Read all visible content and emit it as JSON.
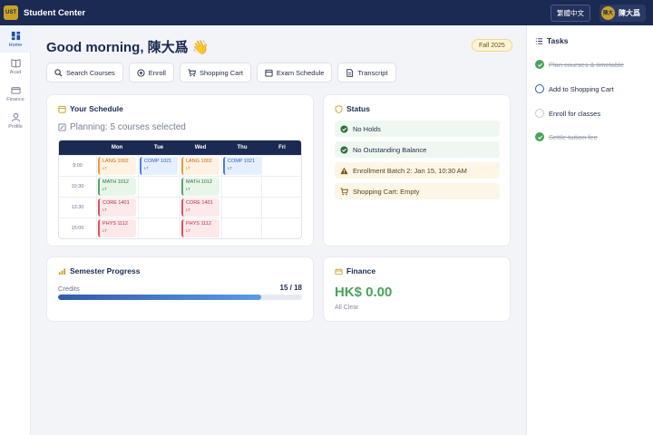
{
  "app": {
    "logo": "UST",
    "title": "Student Center"
  },
  "topbar": {
    "lang_button": "繁體中文",
    "avatar_initials": "陳大",
    "user_name": "陳大爲"
  },
  "nav": [
    {
      "label": "Home",
      "icon": "dashboard-icon",
      "active": true
    },
    {
      "label": "Acad",
      "icon": "book-icon",
      "active": false
    },
    {
      "label": "Finance",
      "icon": "wallet-icon",
      "active": false
    },
    {
      "label": "Profile",
      "icon": "person-icon",
      "active": false
    }
  ],
  "main": {
    "greeting": "Good morning, 陳大爲 👋",
    "term_badge": "Fall 2025",
    "actions": [
      {
        "label": "Search Courses",
        "icon": "search-icon"
      },
      {
        "label": "Enroll",
        "icon": "plus-circle-icon"
      },
      {
        "label": "Shopping Cart",
        "icon": "cart-icon"
      },
      {
        "label": "Exam Schedule",
        "icon": "calendar-icon"
      },
      {
        "label": "Transcript",
        "icon": "document-icon"
      }
    ]
  },
  "schedule": {
    "title": "Your Schedule",
    "planning_text": "Planning: 5 courses selected",
    "days": [
      "Mon",
      "Tue",
      "Wed",
      "Thu",
      "Fri"
    ],
    "times": [
      "9:00",
      "10:30",
      "13:30",
      "15:00"
    ],
    "blocks": [
      {
        "code": "LANG 1002",
        "type": "LT",
        "day": 0,
        "slot": 0,
        "kind": "lang"
      },
      {
        "code": "COMP 1021",
        "type": "LT",
        "day": 1,
        "slot": 0,
        "kind": "comp"
      },
      {
        "code": "LANG 1002",
        "type": "LT",
        "day": 2,
        "slot": 0,
        "kind": "lang"
      },
      {
        "code": "COMP 1021",
        "type": "LT",
        "day": 3,
        "slot": 0,
        "kind": "comp"
      },
      {
        "code": "MATH 1012",
        "type": "LT",
        "day": 0,
        "slot": 1,
        "kind": "math"
      },
      {
        "code": "MATH 1012",
        "type": "LT",
        "day": 2,
        "slot": 1,
        "kind": "math"
      },
      {
        "code": "CORE 1401",
        "type": "LT",
        "day": 0,
        "slot": 2,
        "kind": "core"
      },
      {
        "code": "CORE 1401",
        "type": "LT",
        "day": 2,
        "slot": 2,
        "kind": "core"
      },
      {
        "code": "PHYS 1112",
        "type": "LT",
        "day": 0,
        "slot": 3,
        "kind": "phys"
      },
      {
        "code": "PHYS 1112",
        "type": "LT",
        "day": 2,
        "slot": 3,
        "kind": "phys"
      }
    ]
  },
  "status": {
    "title": "Status",
    "items": [
      {
        "text": "No Holds",
        "level": "ok"
      },
      {
        "text": "No Outstanding Balance",
        "level": "ok"
      },
      {
        "text": "Enrollment Batch 2: Jan 15, 10:30 AM",
        "level": "warn"
      },
      {
        "text": "Shopping Cart: Empty",
        "level": "cart"
      }
    ]
  },
  "progress": {
    "title": "Semester Progress",
    "label": "Credits",
    "value_text": "15 / 18",
    "fraction": 0.833
  },
  "finance": {
    "title": "Finance",
    "amount": "HK$ 0.00",
    "status": "All Clear"
  },
  "tasks": {
    "title": "Tasks",
    "items": [
      {
        "text": "Plan courses & timetable",
        "state": "done"
      },
      {
        "text": "Add to Shopping Cart",
        "state": "current"
      },
      {
        "text": "Enroll for classes",
        "state": "pending"
      },
      {
        "text": "Settle tuition fee",
        "state": "done"
      }
    ]
  },
  "colors": {
    "navy": "#1b2a52",
    "gold": "#c9a227",
    "green": "#4aa35c",
    "blue": "#2f5ba8"
  }
}
